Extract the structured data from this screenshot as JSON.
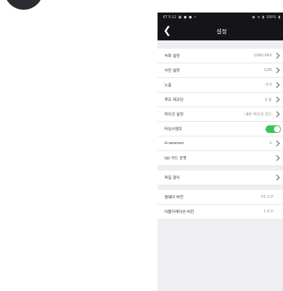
{
  "status_bar": {
    "carrier_time": "KT 5:12",
    "notification_icons": [
      "image-icon",
      "chat-icon",
      "chat-icon",
      "dot-icon"
    ],
    "right_indicators": [
      "alarm-icon",
      "wifi-icon",
      "signal-icon"
    ],
    "battery": "100%"
  },
  "header": {
    "title": "설정",
    "back_icon": "chevron-left-icon"
  },
  "settings": {
    "recording": {
      "label": "녹화 설정",
      "value": "1080 P60"
    },
    "photo": {
      "label": "사진 설정",
      "value": "12M"
    },
    "exposure": {
      "label": "노출",
      "value": "0.0"
    },
    "loop_recording": {
      "label": "루프 레코딩",
      "value": "3 분"
    },
    "mic": {
      "label": "마이크 설정",
      "value": "내부 마이크 모드"
    },
    "timestamp": {
      "label": "타임스탬프",
      "enabled": true,
      "toggle_color": "#3bc454"
    },
    "gsensor": {
      "label": "G-seonsor",
      "value": "2"
    },
    "sd_format": {
      "label": "SD 카드 포맷"
    },
    "file_format": {
      "label": "파일 형식"
    },
    "firmware": {
      "label": "펌웨어 버전",
      "value": "V1.1.0"
    },
    "app_version": {
      "label": "어플리케이션 버전",
      "value": "1.0.0"
    }
  },
  "colors": {
    "header_bg": "#151518",
    "page_bg": "#efeff1",
    "row_bg": "#ffffff"
  }
}
